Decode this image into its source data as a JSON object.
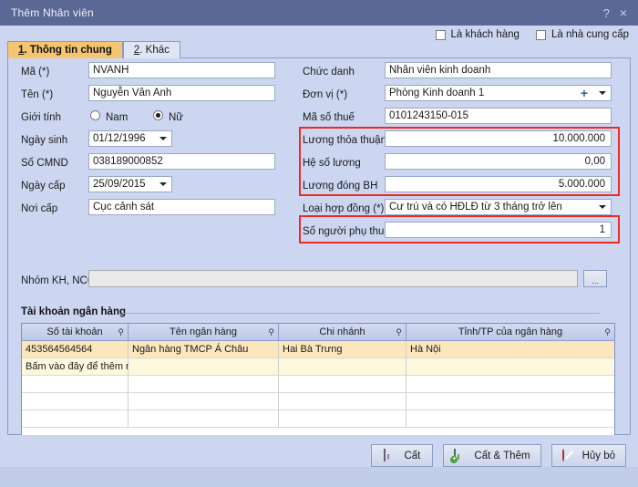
{
  "window": {
    "title": "Thêm Nhân viên",
    "help_label": "?",
    "close_label": "×"
  },
  "top_checkboxes": [
    {
      "label": "Là khách hàng",
      "checked": false
    },
    {
      "label": "Là nhà cung cấp",
      "checked": false
    }
  ],
  "tabs": [
    {
      "accel": "1",
      "label": ". Thông tin chung",
      "active": true
    },
    {
      "accel": "2",
      "label": ". Khác",
      "active": false
    }
  ],
  "left_fields": {
    "ma": {
      "label": "Mã (*)",
      "value": "NVANH"
    },
    "ten": {
      "label": "Tên (*)",
      "value": "Nguyễn Vân Anh"
    },
    "gioi_tinh": {
      "label": "Giới tính",
      "options": [
        "Nam",
        "Nữ"
      ],
      "selected": "Nữ"
    },
    "ngay_sinh": {
      "label": "Ngày sinh",
      "value": "01/12/1996"
    },
    "so_cmnd": {
      "label": "Số CMND",
      "value": "038189000852"
    },
    "ngay_cap": {
      "label": "Ngày cấp",
      "value": "25/09/2015"
    },
    "noi_cap": {
      "label": "Nơi cấp",
      "value": "Cục cảnh sát"
    }
  },
  "right_fields": {
    "chuc_danh": {
      "label": "Chức danh",
      "value": "Nhân viên kinh doanh"
    },
    "don_vi": {
      "label": "Đơn vị (*)",
      "value": "Phòng Kinh doanh 1"
    },
    "ma_so_thue": {
      "label": "Mã số thuế",
      "value": "0101243150-015"
    },
    "luong_thoa_thuan": {
      "label": "Lương thỏa thuận",
      "value": "10.000.000"
    },
    "he_so_luong": {
      "label": "Hệ số lương",
      "value": "0,00"
    },
    "luong_dong_bh": {
      "label": "Lương đóng BH",
      "value": "5.000.000"
    },
    "loai_hop_dong": {
      "label": "Loại hợp đồng (*)",
      "value": "Cư trú và có HĐLĐ từ 3 tháng trở lên"
    },
    "so_nguoi_phu_thuoc": {
      "label": "Số người phụ thuộc",
      "value": "1"
    }
  },
  "nhom_kh_ncc": {
    "label": "Nhóm KH, NCC",
    "value": "",
    "browse_label": "..."
  },
  "bank_group": {
    "title": "Tài khoản ngân hàng",
    "columns": [
      "Số tài khoản",
      "Tên ngân hàng",
      "Chi nhánh",
      "Tỉnh/TP của ngân hàng"
    ],
    "rows": [
      [
        "453564564564",
        "Ngân hàng TMCP Á Châu",
        "Hai Bà Trưng",
        "Hà Nội"
      ]
    ],
    "new_row_hint": "Bấm vào đây để thêm mới",
    "empty_rows": 3
  },
  "footer_buttons": [
    {
      "label": "Cất",
      "icon": "save-icon"
    },
    {
      "label": "Cất & Thêm",
      "icon": "save-add-icon"
    },
    {
      "label": "Hủy bỏ",
      "icon": "cancel-icon"
    }
  ],
  "colors": {
    "titlebar": "#5b6896",
    "dialog_bg": "#ccd6f0",
    "active_tab": "#f5c571",
    "highlight": "#ee2a24",
    "row_data": "#fbe6be",
    "row_new": "#fdf8dc"
  }
}
